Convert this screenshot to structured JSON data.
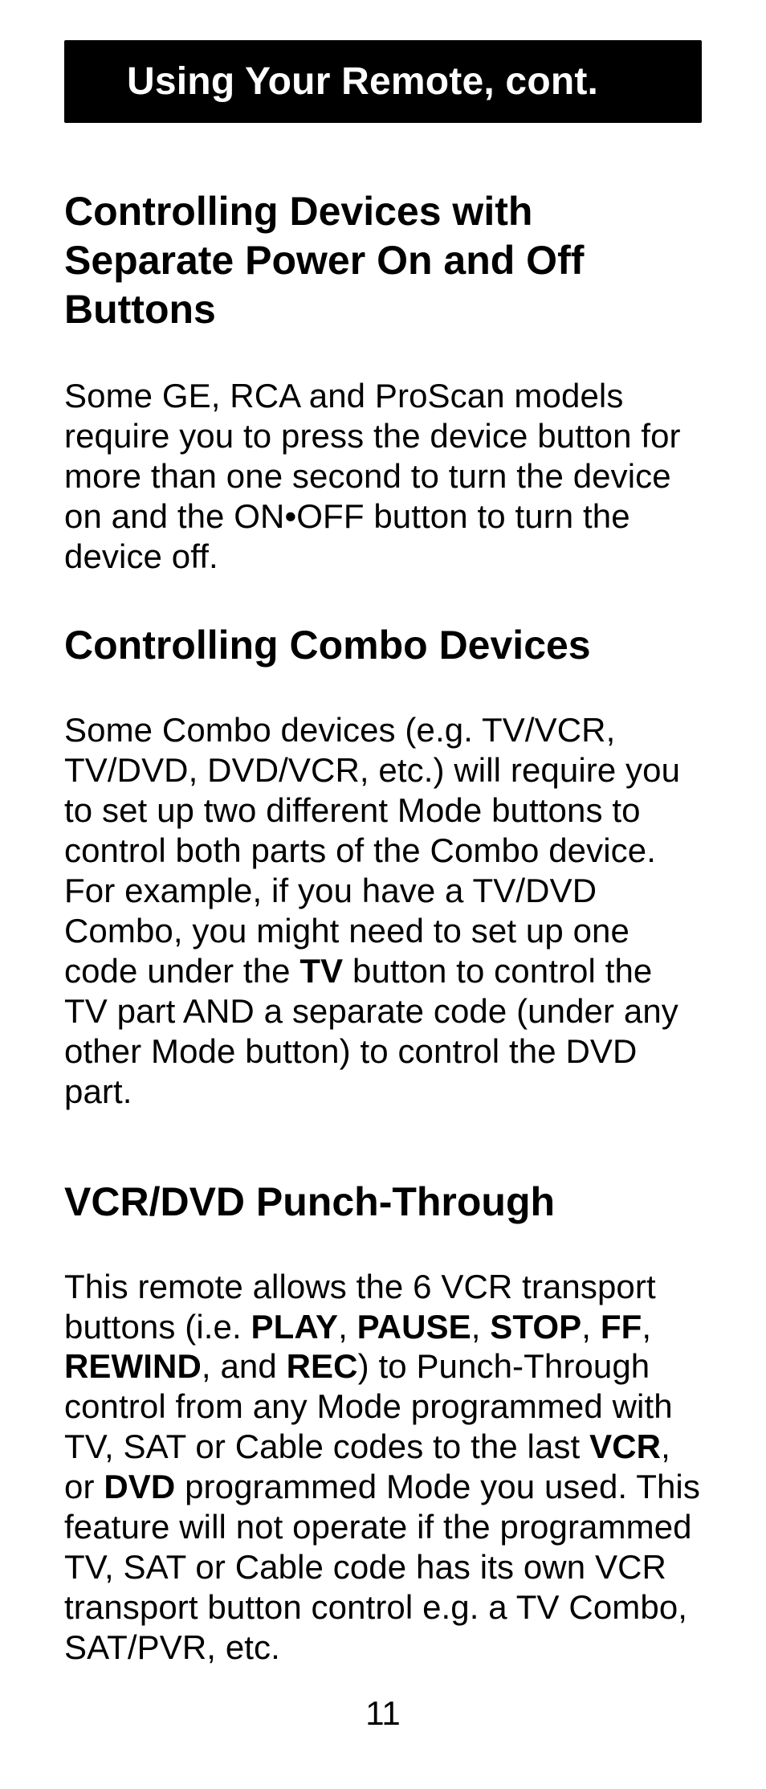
{
  "banner": "Using Your Remote, cont.",
  "section1": {
    "heading": "Controlling Devices with Separate Power On and Off Buttons",
    "body": "Some GE, RCA and ProScan models require you to press the device button for more than one second to turn the device on and the ON•OFF button to turn the device off."
  },
  "section2": {
    "heading": "Controlling Combo Devices",
    "body_a": "Some Combo devices (e.g. TV/VCR, TV/DVD, DVD/VCR, etc.) will require you to set up two different Mode buttons to control both parts of the Combo device. For example, if you have a TV/DVD Combo, you might need to set up one code under the ",
    "bold_tv": "TV",
    "body_b": " button to control the TV part AND a separate code (under any other Mode button) to control the DVD part."
  },
  "section3": {
    "heading": "VCR/DVD Punch-Through",
    "body_a": "This remote allows the 6 VCR transport buttons (i.e. ",
    "bold_play": "PLAY",
    "sep1": ", ",
    "bold_pause": "PAUSE",
    "sep2": ", ",
    "bold_stop": "STOP",
    "sep3": ", ",
    "bold_ff": "FF",
    "sep4": ", ",
    "bold_rewind": "REWIND",
    "sep5": ", and ",
    "bold_rec": "REC",
    "body_b": ") to Punch-Through control from any Mode programmed with TV, SAT or Cable codes to the last ",
    "bold_vcr": "VCR",
    "sep6": ", or ",
    "bold_dvd": "DVD",
    "body_c": " programmed Mode you used. This feature will not operate if the programmed TV, SAT or Cable code has its own VCR transport button control e.g. a TV Combo, SAT/PVR, etc."
  },
  "page_number": "11"
}
